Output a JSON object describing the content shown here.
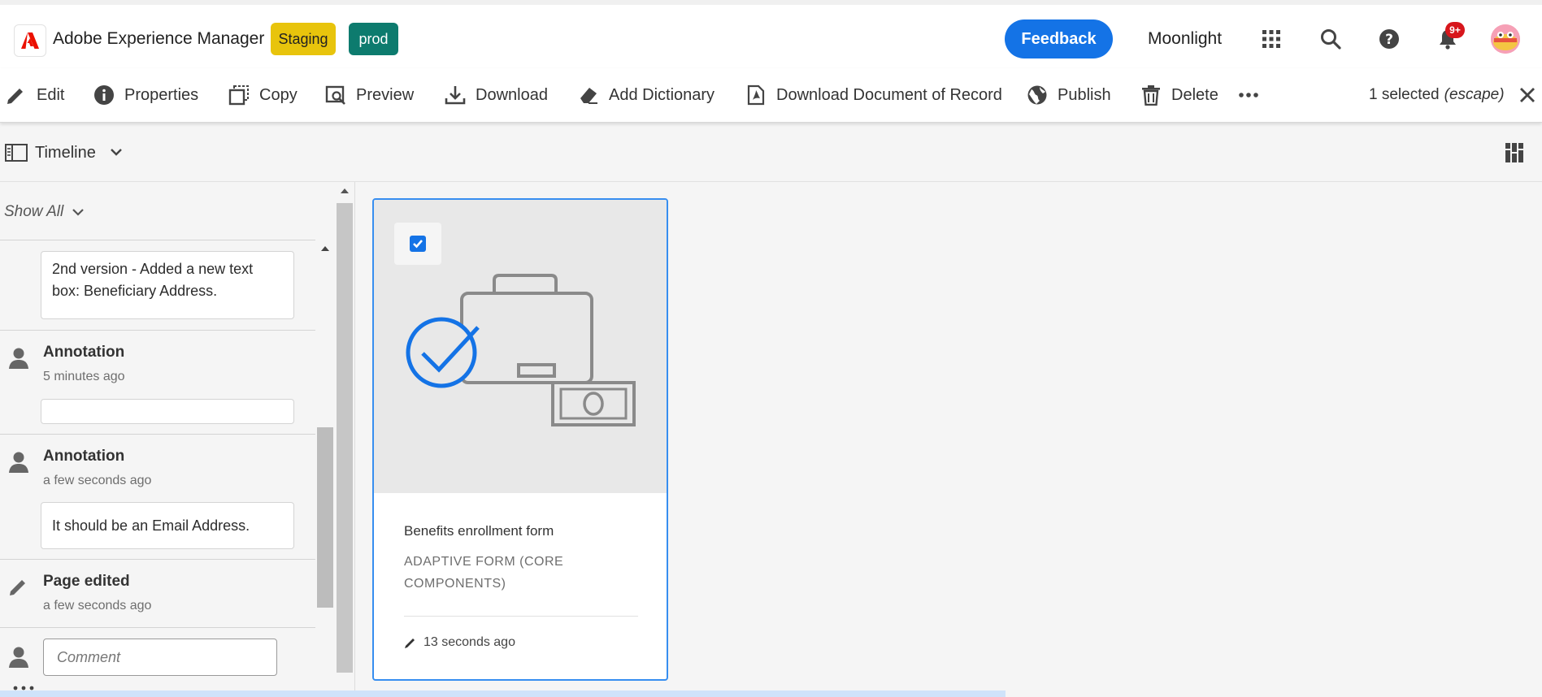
{
  "header": {
    "app_title": "Adobe Experience Manager",
    "env_badges": [
      "Staging",
      "prod"
    ],
    "feedback_label": "Feedback",
    "org_name": "Moonlight",
    "notification_count": "9+",
    "icons": [
      "adobe-logo",
      "apps-grid-icon",
      "search-icon",
      "help-icon",
      "bell-icon",
      "avatar"
    ]
  },
  "actionbar": {
    "actions": [
      "Edit",
      "Properties",
      "Copy",
      "Preview",
      "Download",
      "Add Dictionary",
      "Download Document of Record",
      "Publish",
      "Delete"
    ],
    "selected_text": "1 selected",
    "escape_text": "(escape)"
  },
  "rail": {
    "title": "Timeline",
    "filter_label": "Show All"
  },
  "timeline": {
    "comment_1": "2nd version - Added a new text box: Beneficiary Address.",
    "events": [
      {
        "title": "Annotation",
        "time": "5 minutes ago",
        "comment": ""
      },
      {
        "title": "Annotation",
        "time": "a few seconds ago",
        "comment": "It should be an Email Address."
      },
      {
        "title": "Page edited",
        "time": "a few seconds ago"
      }
    ],
    "comment_placeholder": "Comment"
  },
  "card": {
    "title": "Benefits enrollment form",
    "type": "ADAPTIVE FORM (CORE COMPONENTS)",
    "modified": "13 seconds ago",
    "selected": true
  },
  "colors": {
    "accent": "#1473e6",
    "staging": "#e8c40c",
    "prod": "#0d7b6e",
    "notification": "#d7161c"
  }
}
